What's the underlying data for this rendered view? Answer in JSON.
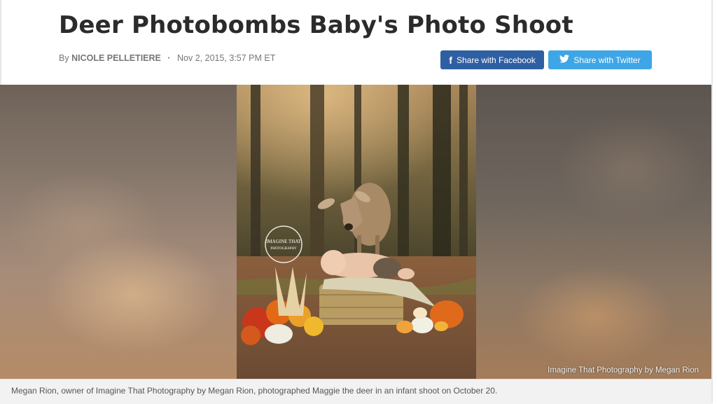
{
  "article": {
    "title": "Deer Photobombs Baby's Photo Shoot",
    "byline_prefix": "By",
    "author": "NICOLE PELLETIERE",
    "date": "Nov 2, 2015, 3:57 PM ET"
  },
  "share": {
    "facebook_label": "Share with Facebook",
    "twitter_label": "Share with Twitter",
    "facebook_icon": "facebook-icon",
    "twitter_icon": "twitter-bird-icon",
    "facebook_color": "#2f5fa3",
    "twitter_color": "#3ea6e6"
  },
  "image": {
    "watermark_line1": "IMAGINE THAT",
    "watermark_line2": "PHOTOGRAPHY",
    "credit": "Imagine That Photography by Megan Rion",
    "caption": "Megan Rion, owner of Imagine That Photography by Megan Rion, photographed Maggie the deer in an infant shoot on October 20."
  }
}
